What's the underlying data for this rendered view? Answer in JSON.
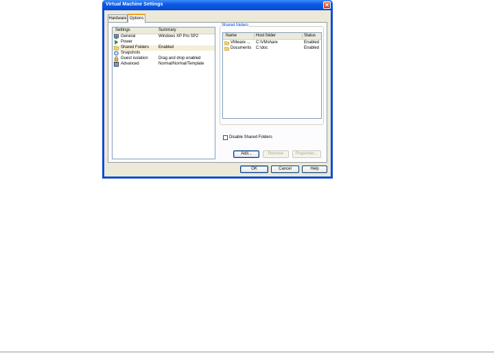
{
  "window": {
    "title": "Virtual Machine Settings",
    "close_symbol": "✕"
  },
  "tabs": [
    {
      "label": "Hardware",
      "active": false
    },
    {
      "label": "Options",
      "active": true
    }
  ],
  "settings_list": {
    "columns": [
      "Settings",
      "Summary"
    ],
    "rows": [
      {
        "name": "General",
        "summary": "Windows XP Pro SP2",
        "icon": "computer-icon",
        "selected": false
      },
      {
        "name": "Power",
        "summary": "",
        "icon": "play-icon",
        "selected": false
      },
      {
        "name": "Shared Folders",
        "summary": "Enabled",
        "icon": "folder-icon",
        "selected": true
      },
      {
        "name": "Snapshots",
        "summary": "",
        "icon": "snapshot-icon",
        "selected": false
      },
      {
        "name": "Guest isolation",
        "summary": "Drag and drop enabled",
        "icon": "lock-icon",
        "selected": false
      },
      {
        "name": "Advanced",
        "summary": "Normal/Normal/Template",
        "icon": "advanced-icon",
        "selected": false
      }
    ]
  },
  "shared_folders": {
    "group_label": "Shared folders",
    "columns": [
      "Name",
      "Host folder",
      "Status"
    ],
    "rows": [
      {
        "name": "VMware ...",
        "host_folder": "C:\\VMshare",
        "status": "Enabled"
      },
      {
        "name": "Documents",
        "host_folder": "C:\\doc",
        "status": "Enabled"
      }
    ],
    "disable_label": "Disable Shared Folders",
    "disable_checked": false,
    "buttons": {
      "add": "Add...",
      "remove": "Remove",
      "properties": "Properties..."
    }
  },
  "footer_buttons": {
    "ok": "OK",
    "cancel": "Cancel",
    "help": "Help"
  },
  "colors": {
    "titlebar": "#0a4fd8",
    "selection": "#f4efd8",
    "group_label": "#0046d5",
    "tab_highlight": "#f2a21f"
  }
}
